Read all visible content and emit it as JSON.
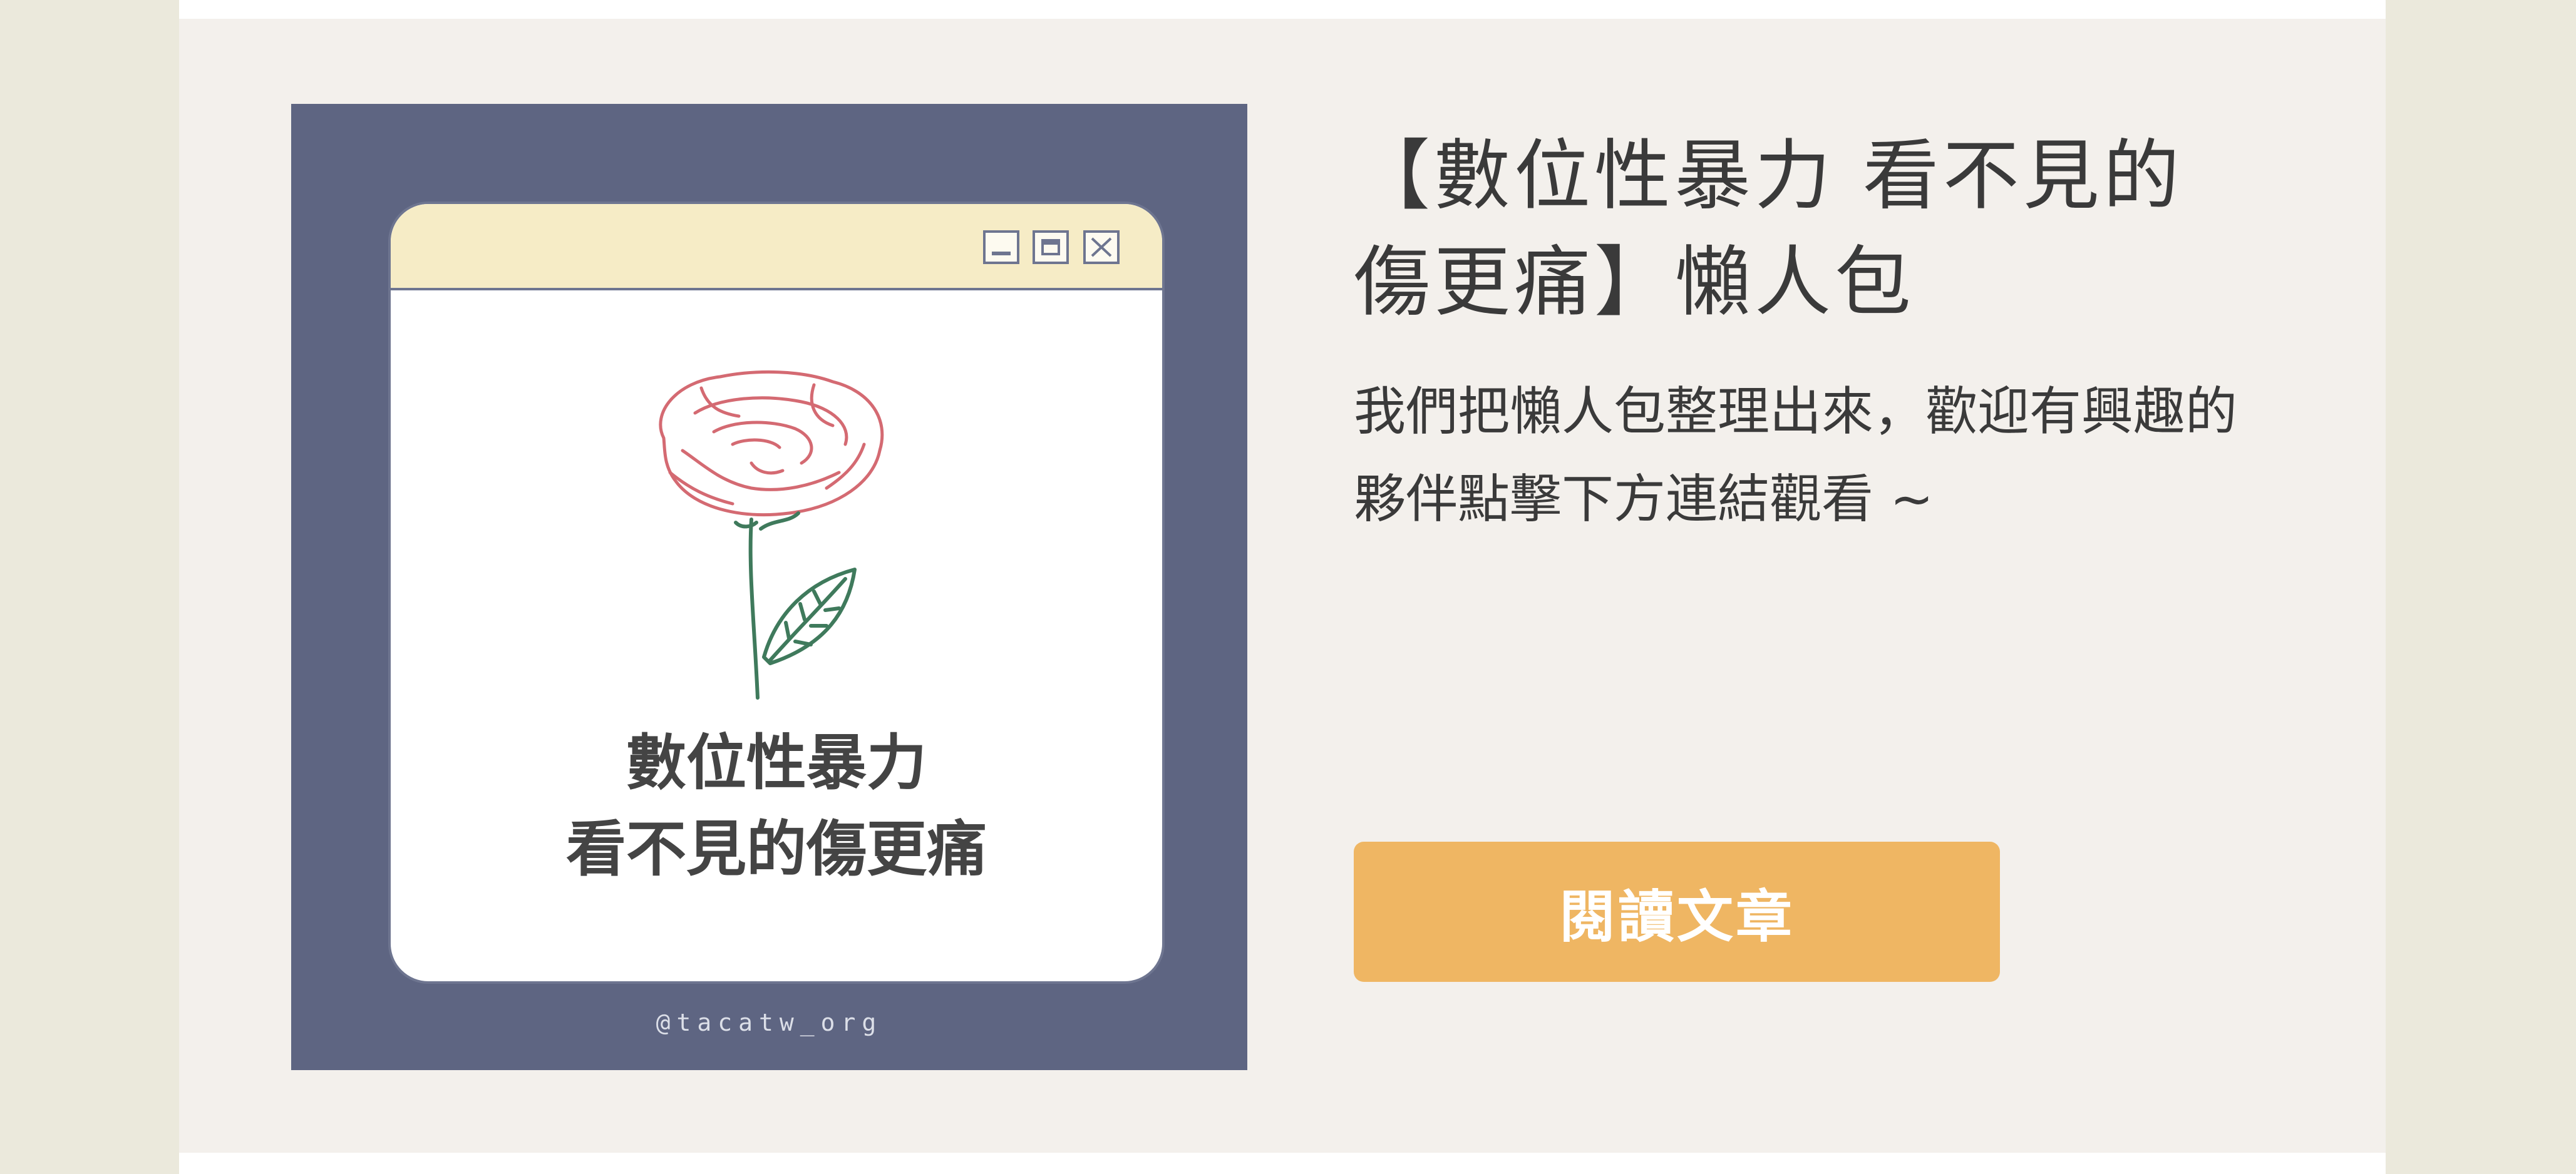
{
  "thumbnail": {
    "title_line1": "數位性暴力",
    "title_line2": "看不見的傷更痛",
    "handle": "@tacatw_org",
    "background_color": "#5e6582",
    "window_bar_color": "#f6ecc6",
    "window_controls": [
      "minimize-icon",
      "maximize-icon",
      "close-icon"
    ],
    "illustration": "rose-icon"
  },
  "article": {
    "headline": "【數位性暴力 看不見的傷更痛】懶人包",
    "description": "我們把懶人包整理出來，歡迎有興趣的夥伴點擊下方連結觀看 ~",
    "read_button_label": "閱讀文章",
    "button_color": "#efb663"
  },
  "colors": {
    "page_background": "#ebe9dc",
    "card_background": "#f3f0ec",
    "text": "#3a3a3a"
  }
}
